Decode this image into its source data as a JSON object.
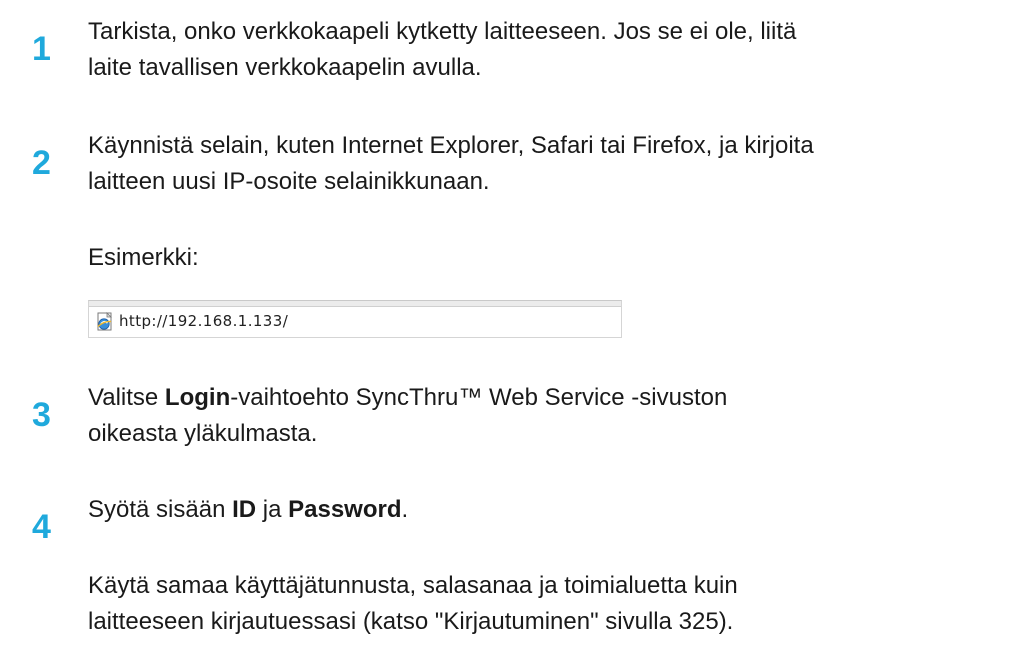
{
  "steps": [
    {
      "number": "1",
      "lines": [
        "Tarkista, onko verkkokaapeli kytketty laitteeseen. Jos se ei ole, liitä",
        "laite tavallisen verkkokaapelin avulla."
      ]
    },
    {
      "number": "2",
      "lines": [
        "Käynnistä selain, kuten Internet Explorer, Safari tai Firefox, ja kirjoita",
        "laitteen uusi IP-osoite selainikkunaan."
      ],
      "example_label": "Esimerkki:"
    },
    {
      "number": "3",
      "line1_pre": "Valitse ",
      "line1_bold": "Login",
      "line1_post": "-vaihtoehto SyncThru™ Web Service -sivuston",
      "line2": "oikeasta yläkulmasta."
    },
    {
      "number": "4",
      "line1_pre": "Syötä sisään ",
      "line1_bold1": "ID",
      "line1_mid": " ja ",
      "line1_bold2": "Password",
      "line1_post": ".",
      "note_lines": [
        "Käytä samaa käyttäjätunnusta, salasanaa ja toimialuetta kuin",
        "laitteeseen kirjautuessasi (katso \"Kirjautuminen\" sivulla 325)."
      ]
    }
  ],
  "address_bar": {
    "url": "http://192.168.1.133/",
    "icon": "ie-page-icon"
  },
  "colors": {
    "step_number": "#1fa9dc",
    "text": "#1a1a1a"
  }
}
